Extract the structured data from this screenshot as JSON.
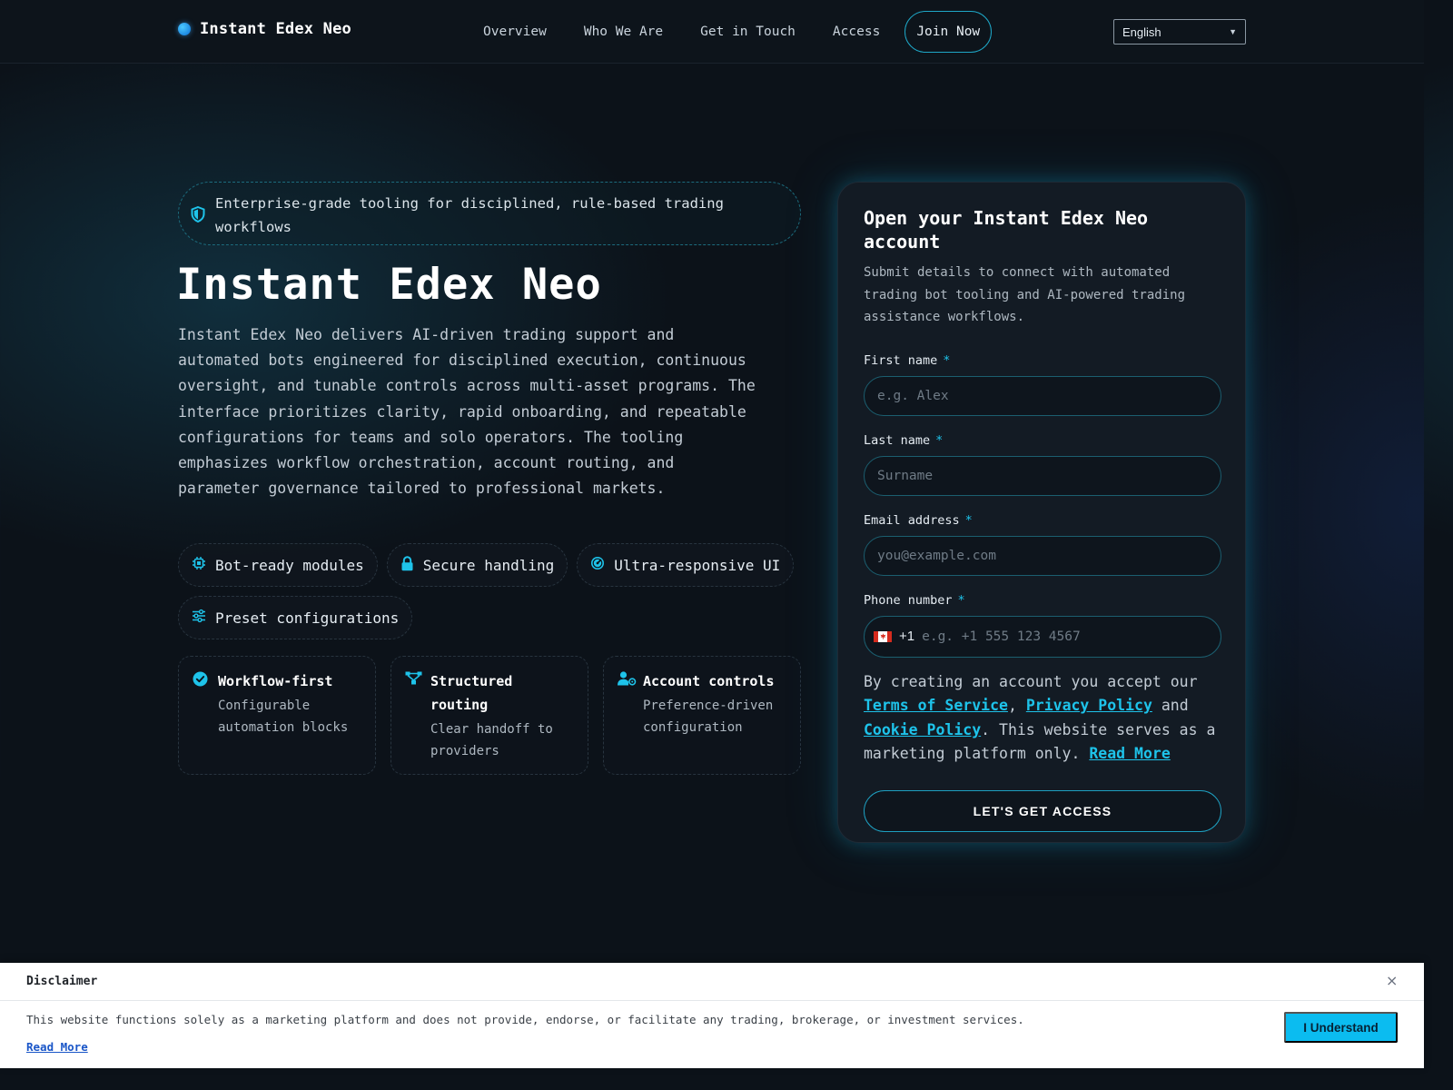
{
  "header": {
    "brand": "Instant Edex Neo",
    "nav": [
      "Overview",
      "Who We Are",
      "Get in Touch",
      "Access"
    ],
    "join_label": "Join Now",
    "language": "English"
  },
  "hero": {
    "tagline": "Enterprise-grade tooling for disciplined, rule-based trading workflows",
    "title": "Instant Edex Neo",
    "description": "Instant Edex Neo delivers AI-driven trading support and automated bots engineered for disciplined execution, continuous oversight, and tunable controls across multi-asset programs. The interface prioritizes clarity, rapid onboarding, and repeatable configurations for teams and solo operators. The tooling emphasizes workflow orchestration, account routing, and parameter governance tailored to professional markets.",
    "chips": [
      {
        "label": "Bot-ready modules",
        "icon": "chip-icon"
      },
      {
        "label": "Secure handling",
        "icon": "lock-icon"
      },
      {
        "label": "Ultra-responsive UI",
        "icon": "gauge-icon"
      },
      {
        "label": "Preset configurations",
        "icon": "sliders-icon"
      }
    ],
    "cards": [
      {
        "title": "Workflow-first",
        "subtitle": "Configurable automation blocks",
        "icon": "check-circle-icon"
      },
      {
        "title": "Structured routing",
        "subtitle": "Clear handoff to providers",
        "icon": "routing-icon"
      },
      {
        "title": "Account controls",
        "subtitle": "Preference-driven configuration",
        "icon": "user-settings-icon"
      }
    ]
  },
  "form": {
    "title": "Open your Instant Edex Neo account",
    "subtitle": "Submit details to connect with automated trading bot tooling and AI-powered trading assistance workflows.",
    "required_mark": "*",
    "first_name": {
      "label": "First name",
      "placeholder": "e.g. Alex"
    },
    "last_name": {
      "label": "Last name",
      "placeholder": "Surname"
    },
    "email": {
      "label": "Email address",
      "placeholder": "you@example.com"
    },
    "phone": {
      "label": "Phone number",
      "dial_code": "+1",
      "placeholder": "e.g. +1 555 123 4567",
      "flag": "canada-flag-icon"
    },
    "consent": {
      "prefix": "By creating an account you accept our ",
      "terms": "Terms of Service",
      "sep1": ", ",
      "privacy": "Privacy Policy",
      "sep2": " and ",
      "cookie": "Cookie Policy",
      "suffix": ". This website serves as a marketing platform only. ",
      "read_more": "Read More"
    },
    "submit_label": "LET'S GET ACCESS"
  },
  "disclaimer": {
    "title": "Disclaimer",
    "text": "This website functions solely as a marketing platform and does not provide, endorse, or facilitate any trading, brokerage, or investment services.",
    "read_more": "Read More",
    "button": "I Understand",
    "close": "×"
  },
  "colors": {
    "accent": "#1ec3ea",
    "background": "#0c1219",
    "panel": "#131b24",
    "button_bright": "#0bbcf0"
  }
}
